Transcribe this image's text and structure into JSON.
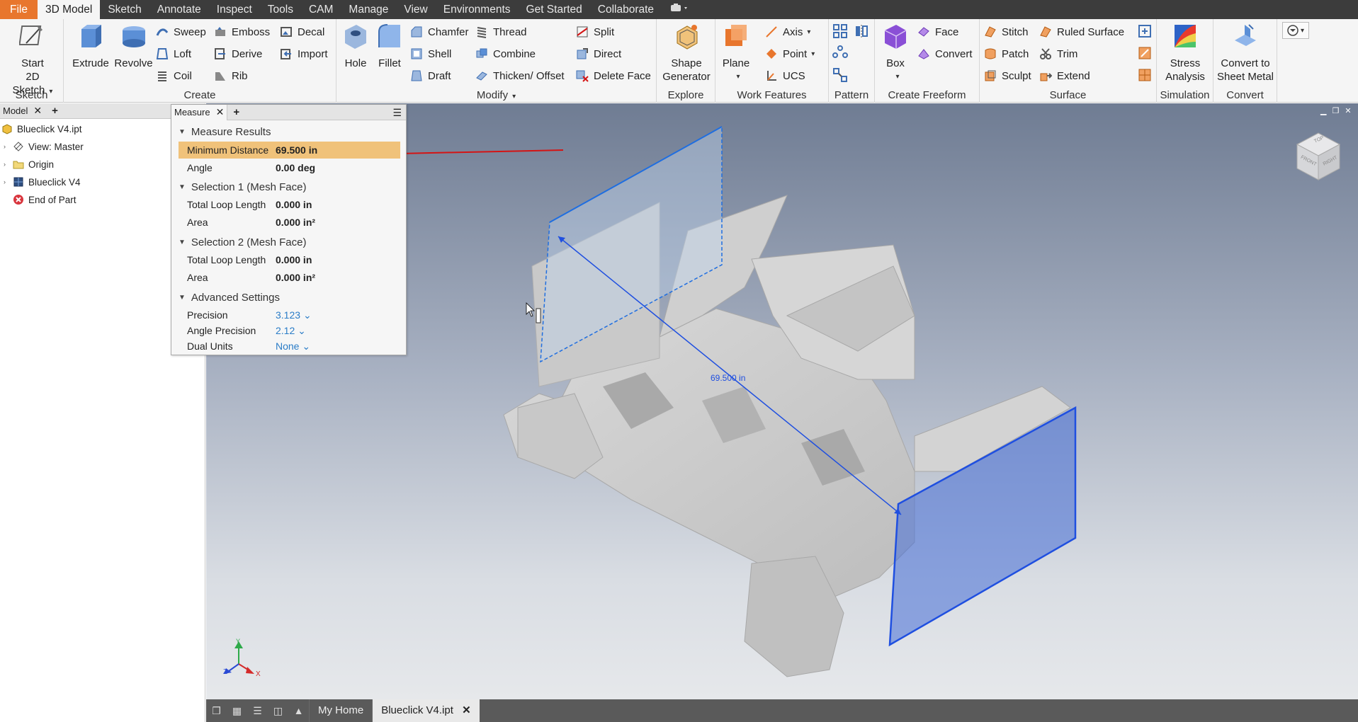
{
  "menu": {
    "tabs": [
      "File",
      "3D Model",
      "Sketch",
      "Annotate",
      "Inspect",
      "Tools",
      "CAM",
      "Manage",
      "View",
      "Environments",
      "Get Started",
      "Collaborate"
    ],
    "active_tab": "3D Model"
  },
  "ribbon": {
    "groups": {
      "sketch": "Sketch",
      "create": "Create",
      "modify": "Modify",
      "explore": "Explore",
      "work_features": "Work Features",
      "pattern": "Pattern",
      "create_freeform": "Create Freeform",
      "surface": "Surface",
      "simulation": "Simulation",
      "convert": "Convert"
    },
    "start_sketch": [
      "Start",
      "2D Sketch"
    ],
    "extrude": "Extrude",
    "revolve": "Revolve",
    "sweep": "Sweep",
    "loft": "Loft",
    "coil": "Coil",
    "emboss": "Emboss",
    "derive": "Derive",
    "rib": "Rib",
    "decal": "Decal",
    "import": "Import",
    "hole": "Hole",
    "fillet": "Fillet",
    "chamfer": "Chamfer",
    "shell": "Shell",
    "draft": "Draft",
    "thread": "Thread",
    "combine": "Combine",
    "thicken": "Thicken/ Offset",
    "split": "Split",
    "direct": "Direct",
    "delete_face": "Delete Face",
    "shape_generator": [
      "Shape",
      "Generator"
    ],
    "plane": "Plane",
    "axis": "Axis",
    "point": "Point",
    "ucs": "UCS",
    "box": "Box",
    "face": "Face",
    "convert_ff": "Convert",
    "stitch": "Stitch",
    "patch": "Patch",
    "sculpt": "Sculpt",
    "ruled_surface": "Ruled Surface",
    "trim": "Trim",
    "extend": "Extend",
    "stress_analysis": [
      "Stress",
      "Analysis"
    ],
    "convert_sheet_metal": [
      "Convert to",
      "Sheet Metal"
    ]
  },
  "browser": {
    "tab_label": "Model",
    "items": [
      {
        "label": "Blueclick V4.ipt"
      },
      {
        "label": "View: Master"
      },
      {
        "label": "Origin"
      },
      {
        "label": "Blueclick V4"
      },
      {
        "label": "End of Part"
      }
    ]
  },
  "measure": {
    "tab_label": "Measure",
    "results_header": "Measure Results",
    "min_distance_label": "Minimum Distance",
    "min_distance_value": "69.500 in",
    "angle_label": "Angle",
    "angle_value": "0.00 deg",
    "selection1_header": "Selection 1 (Mesh Face)",
    "selection1_loop_label": "Total Loop Length",
    "selection1_loop_value": "0.000 in",
    "selection1_area_label": "Area",
    "selection1_area_value": "0.000 in²",
    "selection2_header": "Selection 2 (Mesh Face)",
    "selection2_loop_label": "Total Loop Length",
    "selection2_loop_value": "0.000 in",
    "selection2_area_label": "Area",
    "selection2_area_value": "0.000 in²",
    "advanced_header": "Advanced Settings",
    "precision_label": "Precision",
    "precision_value": "3.123",
    "angle_precision_label": "Angle Precision",
    "angle_precision_value": "2.12",
    "dual_units_label": "Dual Units",
    "dual_units_value": "None"
  },
  "viewport": {
    "dimension_label": "69.500 in",
    "viewcube": {
      "top": "TOP",
      "front": "FRONT",
      "right": "RIGHT"
    },
    "axes": {
      "x": "X",
      "y": "Y",
      "z": "Z"
    }
  },
  "doc_tabs": {
    "home": "My Home",
    "active": "Blueclick V4.ipt"
  },
  "colors": {
    "file_tab": "#e8762d",
    "highlight_row": "#f0c27a",
    "selection_blue": "#1f4fe0",
    "annotation_red": "#d41414",
    "link_blue": "#2a7cc7"
  }
}
